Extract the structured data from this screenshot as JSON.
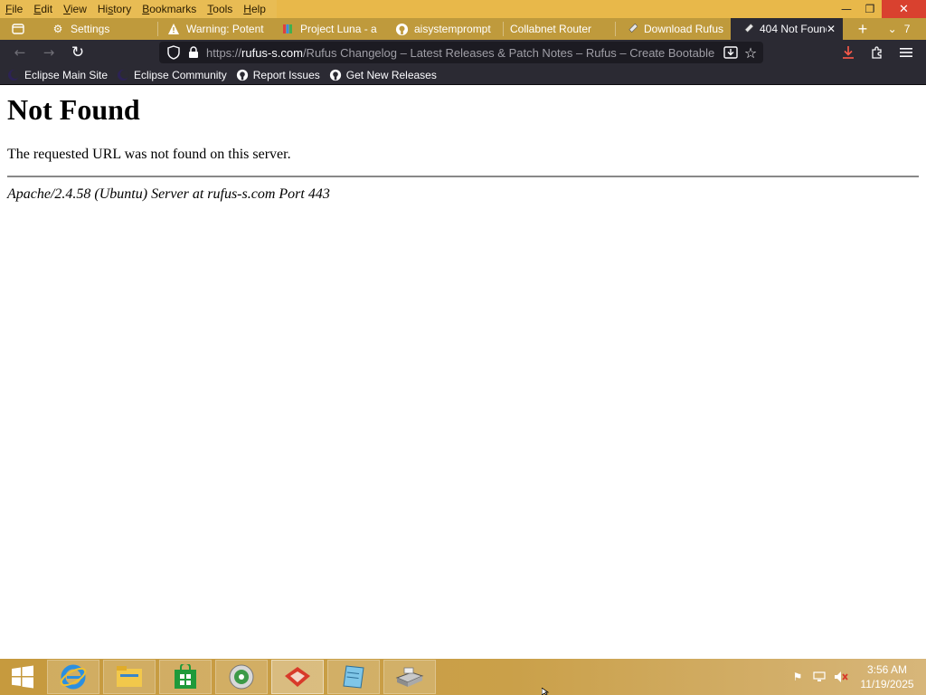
{
  "menu": {
    "items": [
      {
        "label": "File",
        "key": "F"
      },
      {
        "label": "Edit",
        "key": "E"
      },
      {
        "label": "View",
        "key": "V"
      },
      {
        "label": "History",
        "key": "s"
      },
      {
        "label": "Bookmarks",
        "key": "B"
      },
      {
        "label": "Tools",
        "key": "T"
      },
      {
        "label": "Help",
        "key": "H"
      }
    ]
  },
  "window_controls": {
    "minimize": "—",
    "restore": "❐",
    "close": "✕"
  },
  "tabs": [
    {
      "label": "Settings",
      "icon": "gear-icon"
    },
    {
      "label": "Warning: Potent",
      "icon": "warning-icon"
    },
    {
      "label": "Project Luna - a",
      "icon": "pencil-icon"
    },
    {
      "label": "aisystemprompt",
      "icon": "github-icon"
    },
    {
      "label": "Collabnet Router",
      "icon": ""
    },
    {
      "label": "Download Rufus",
      "icon": "usb-icon"
    },
    {
      "label": "404 Not Found",
      "icon": "usb-icon",
      "active": true
    }
  ],
  "tab_strip": {
    "new_tab": "+",
    "list_all_count": "7"
  },
  "navbar": {
    "back": "←",
    "forward": "→",
    "reload": "↻",
    "url_domain_prefix": "https://",
    "url_domain": "rufus-s.com",
    "url_path": "/Rufus Changelog – Latest Releases & Patch Notes – Rufus – Create Bootable"
  },
  "bookmarks": [
    {
      "label": "Eclipse Main Site",
      "icon": "eclipse-icon"
    },
    {
      "label": "Eclipse Community",
      "icon": "eclipse-icon"
    },
    {
      "label": "Report Issues",
      "icon": "github-icon"
    },
    {
      "label": "Get New Releases",
      "icon": "github-icon"
    }
  ],
  "page": {
    "heading": "Not Found",
    "message": "The requested URL was not found on this server.",
    "signature": "Apache/2.4.58 (Ubuntu) Server at rufus-s.com Port 443"
  },
  "taskbar": {
    "apps": [
      "start-button",
      "internet-explorer",
      "file-explorer",
      "store",
      "media-center",
      "app-red",
      "app-notepad",
      "app-scanner"
    ],
    "clock_time": "3:56 AM",
    "clock_date": "11/19/2025"
  },
  "colors": {
    "accent_gold": "#e8bc54",
    "tab_strip": "#bf9a3c",
    "toolbar_dark": "#2b2a33",
    "close_red": "#d9412f"
  }
}
